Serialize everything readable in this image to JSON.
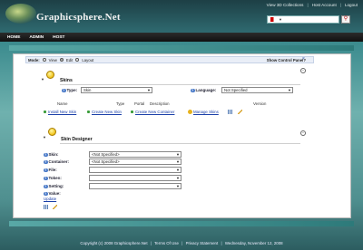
{
  "brand": {
    "logo_text": "Graphicsphere.Net"
  },
  "top_links": [
    "View 3D Collections",
    "Host Account",
    "Logout"
  ],
  "language_select": {
    "value": ""
  },
  "nav": [
    "HOME",
    "ADMIN",
    "HOST"
  ],
  "mode_bar": {
    "label": "Mode:",
    "options": [
      "View",
      "Edit",
      "Layout"
    ],
    "selected": "Edit",
    "show_control_panel": "Show Control Panel?"
  },
  "skins": {
    "title": "Skins",
    "type_label": "Type:",
    "type_value": "Skin",
    "language_label": "Language:",
    "language_value": "Not Specified",
    "columns": [
      "Name",
      "Type",
      "Portal",
      "Description",
      "Version"
    ],
    "actions": [
      "Install New Skin",
      "Create New Skin",
      "Create New Container",
      "Manage Skins"
    ]
  },
  "skin_designer": {
    "title": "Skin Designer",
    "fields": [
      {
        "label": "Skin:",
        "value": "<Not Specified>"
      },
      {
        "label": "Container:",
        "value": "<Not Specified>"
      },
      {
        "label": "File:",
        "value": ""
      },
      {
        "label": "Token:",
        "value": ""
      },
      {
        "label": "Setting:",
        "value": ""
      },
      {
        "label": "Value:",
        "value": ""
      }
    ],
    "update_link": "Update"
  },
  "footer": {
    "copyright": "Copyright (c) 2008 Graphicsphere.Net",
    "terms": "Terms Of Use",
    "privacy": "Privacy Statement",
    "date": "Wednesday, November 12, 2008"
  },
  "colors": {
    "accent": "#2f6a70",
    "link": "#1a3fa8",
    "navbar": "#101010"
  }
}
